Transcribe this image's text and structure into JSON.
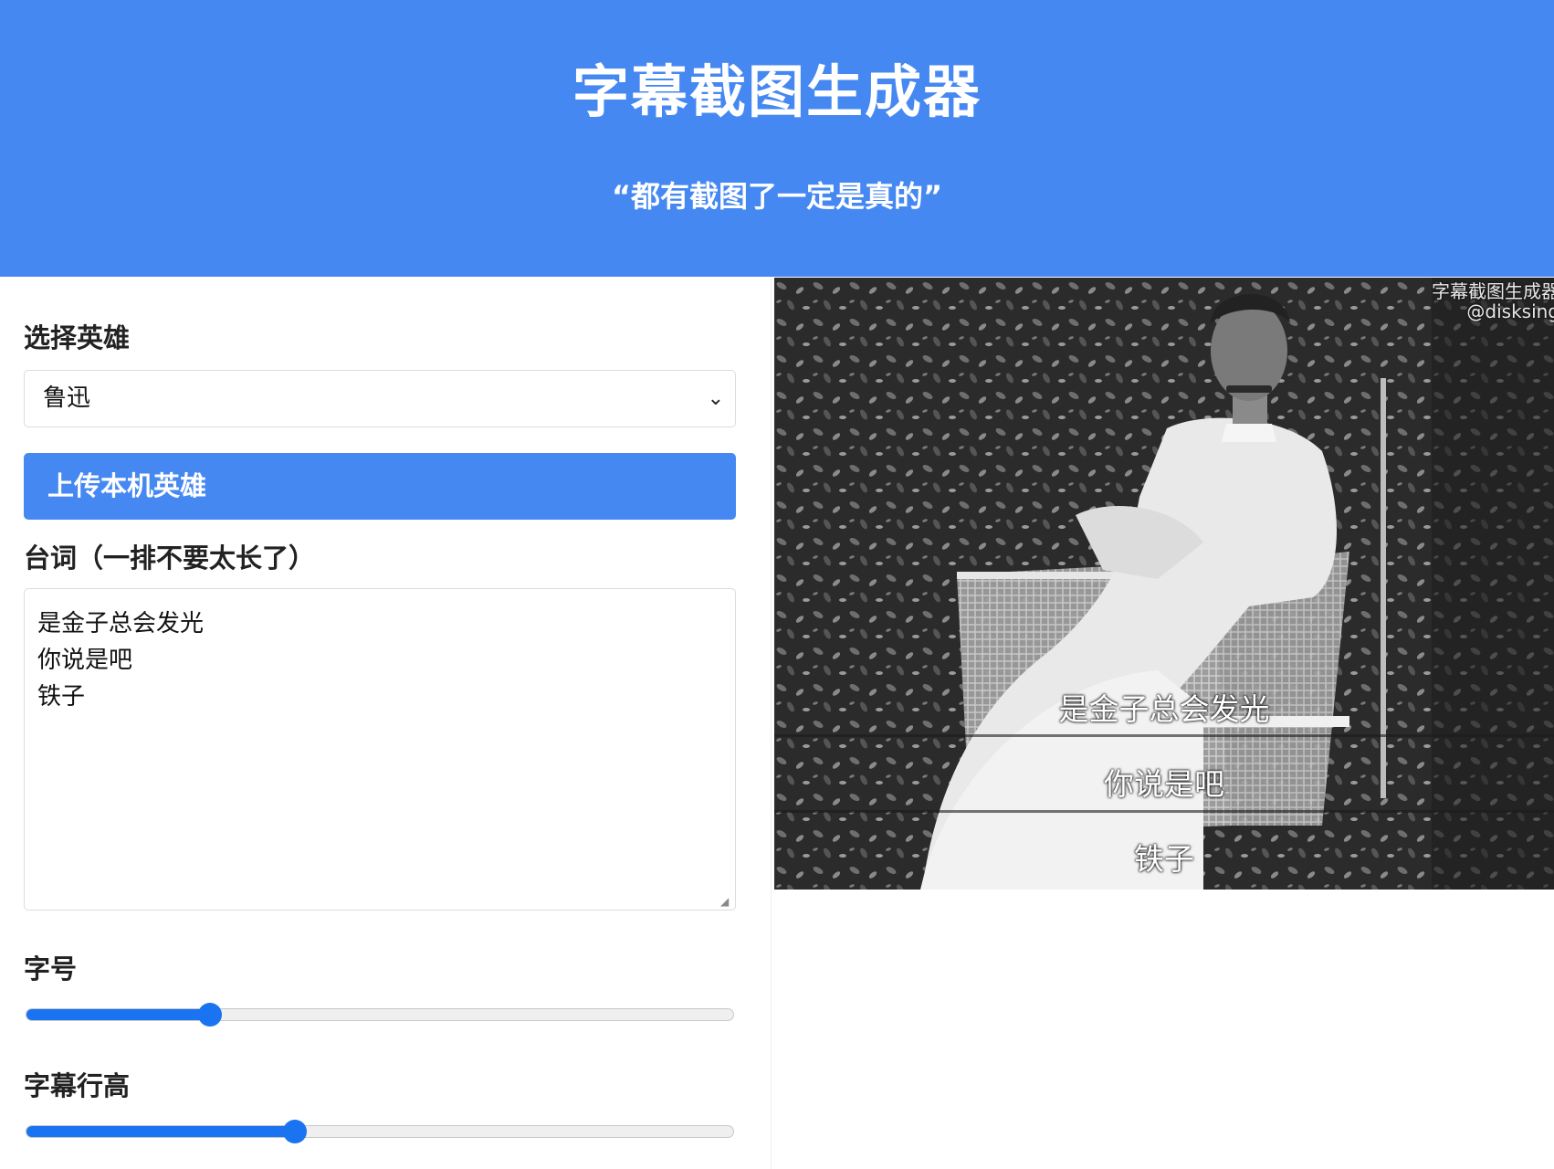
{
  "header": {
    "title": "字幕截图生成器",
    "subtitle": "“都有截图了一定是真的”"
  },
  "form": {
    "hero_label": "选择英雄",
    "hero_selected": "鲁迅",
    "upload_button": "上传本机英雄",
    "lines_label": "台词（一排不要太长了）",
    "lines": [
      "是金子总会发光",
      "你说是吧",
      "铁子"
    ],
    "font_size_label": "字号",
    "font_size_value": 0.26,
    "line_height_label": "字幕行高",
    "line_height_value": 0.38
  },
  "preview": {
    "watermark_line1": "字幕截图生成器",
    "watermark_line2": "@disksing",
    "subtitles": [
      "是金子总会发光",
      "你说是吧",
      "铁子"
    ]
  },
  "colors": {
    "header_bg": "#4688f1",
    "button_bg": "#4688f1",
    "slider_fill": "#1a73f0"
  }
}
